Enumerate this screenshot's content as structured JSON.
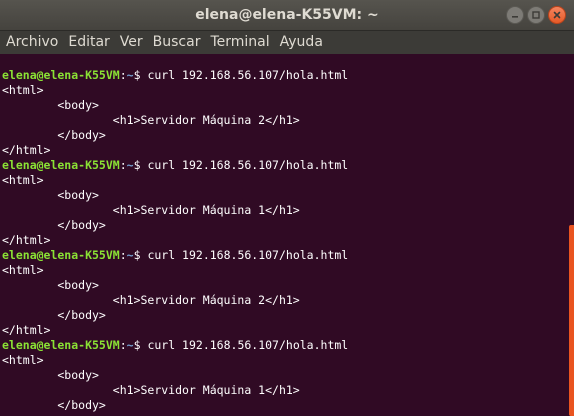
{
  "window": {
    "title": "elena@elena-K55VM: ~"
  },
  "menu": {
    "items": [
      "Archivo",
      "Editar",
      "Ver",
      "Buscar",
      "Terminal",
      "Ayuda"
    ]
  },
  "terminal": {
    "prompt_user": "elena@elena-K55VM",
    "prompt_sep": ":",
    "prompt_path": "~",
    "prompt_end": "$ ",
    "command": "curl 192.168.56.107/hola.html",
    "blocks": [
      {
        "lines": [
          "<html>",
          "        <body>",
          "                <h1>Servidor Máquina 2</h1>",
          "        </body>",
          "</html>"
        ]
      },
      {
        "lines": [
          "<html>",
          "        <body>",
          "                <h1>Servidor Máquina 1</h1>",
          "        </body>",
          "</html>"
        ]
      },
      {
        "lines": [
          "<html>",
          "        <body>",
          "                <h1>Servidor Máquina 2</h1>",
          "        </body>",
          "</html>"
        ]
      },
      {
        "lines": [
          "<html>",
          "        <body>",
          "                <h1>Servidor Máquina 1</h1>",
          "        </body>"
        ]
      }
    ]
  },
  "colors": {
    "background": "#300a24",
    "prompt_user": "#8ae234",
    "prompt_path": "#729fcf",
    "scrollbar": "#e95420"
  }
}
